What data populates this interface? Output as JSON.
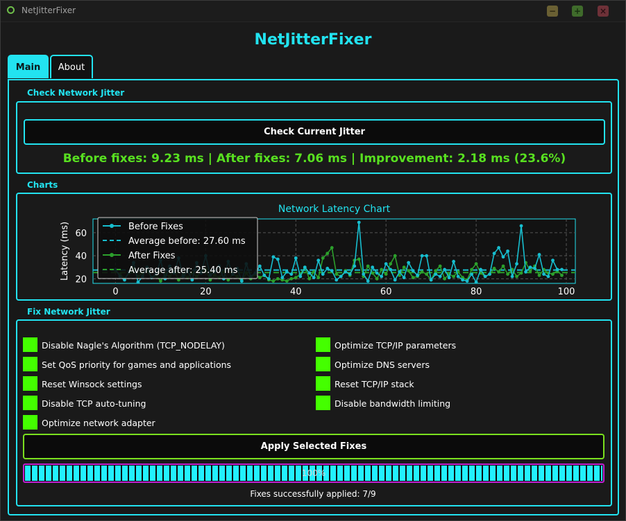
{
  "window": {
    "title": "NetJitterFixer",
    "minimize_glyph": "−",
    "maximize_glyph": "+",
    "close_glyph": "×",
    "icon": "app-ring-icon"
  },
  "app_title": "NetJitterFixer",
  "tabs": [
    {
      "label": "Main",
      "active": true
    },
    {
      "label": "About",
      "active": false
    }
  ],
  "check_section": {
    "label": "Check Network Jitter",
    "button_label": "Check Current Jitter",
    "result_text": "Before fixes: 9.23 ms | After fixes: 7.06 ms | Improvement: 2.18 ms (23.6%)"
  },
  "charts_section": {
    "label": "Charts"
  },
  "chart_data": {
    "type": "line",
    "title": "Network Latency Chart",
    "xlabel": "",
    "ylabel": "Latency (ms)",
    "xlim": [
      -5,
      102
    ],
    "ylim": [
      16,
      72
    ],
    "xticks": [
      0,
      20,
      40,
      60,
      80,
      100
    ],
    "yticks": [
      20,
      40,
      60
    ],
    "grid": true,
    "legend_position": "top-left",
    "series": [
      {
        "name": "Before Fixes",
        "color": "#17becf",
        "values": [
          28,
          22,
          19,
          26,
          34,
          17,
          22,
          30,
          21,
          24,
          36,
          20,
          31,
          25,
          38,
          22,
          27,
          19,
          34,
          25,
          40,
          23,
          26,
          31,
          20,
          35,
          24,
          29,
          18,
          33,
          22,
          25,
          31,
          23,
          20,
          39,
          37,
          21,
          26,
          24,
          38,
          22,
          30,
          25,
          21,
          36,
          24,
          29,
          27,
          19,
          22,
          26,
          24,
          31,
          69,
          24,
          18,
          30,
          25,
          22,
          33,
          28,
          19,
          26,
          21,
          34,
          27,
          23,
          40,
          40,
          19,
          24,
          22,
          28,
          21,
          35,
          22,
          19,
          18,
          24,
          17,
          28,
          22,
          24,
          42,
          47,
          39,
          44,
          22,
          33,
          66,
          26,
          30,
          29,
          41,
          24,
          22,
          36,
          28,
          28
        ]
      },
      {
        "name": "After Fixes",
        "color": "#2ca02c",
        "values": [
          27,
          24,
          20,
          25,
          29,
          22,
          25,
          27,
          21,
          23,
          18,
          24,
          22,
          27,
          19,
          24,
          21,
          25,
          22,
          26,
          28,
          19,
          23,
          21,
          26,
          19,
          24,
          22,
          18,
          25,
          20,
          24,
          21,
          23,
          19,
          18,
          20,
          19,
          18,
          20,
          21,
          24,
          30,
          20,
          26,
          21,
          38,
          42,
          47,
          24,
          22,
          27,
          23,
          36,
          37,
          22,
          31,
          25,
          20,
          28,
          24,
          33,
          40,
          23,
          30,
          27,
          21,
          22,
          26,
          24,
          19,
          27,
          31,
          20,
          24,
          22,
          26,
          21,
          19,
          28,
          33,
          25,
          22,
          24,
          29,
          26,
          31,
          24,
          28,
          22,
          25,
          34,
          27,
          31,
          23,
          28,
          25,
          24,
          27,
          23
        ]
      },
      {
        "name": "Average before: 27.60 ms",
        "color": "#17becf",
        "style": "dashed",
        "value": 27.6
      },
      {
        "name": "Average after: 25.40 ms",
        "color": "#2ca02c",
        "style": "dashed",
        "value": 25.4
      }
    ]
  },
  "fix_section": {
    "label": "Fix Network Jitter",
    "options": [
      {
        "label": "Disable Nagle's Algorithm (TCP_NODELAY)",
        "checked": true
      },
      {
        "label": "Optimize TCP/IP parameters",
        "checked": true
      },
      {
        "label": "Set QoS priority for games and applications",
        "checked": true
      },
      {
        "label": "Optimize DNS servers",
        "checked": true
      },
      {
        "label": "Reset Winsock settings",
        "checked": true
      },
      {
        "label": "Reset TCP/IP stack",
        "checked": true
      },
      {
        "label": "Disable TCP auto-tuning",
        "checked": true
      },
      {
        "label": "Disable bandwidth limiting",
        "checked": true
      },
      {
        "label": "Optimize network adapter",
        "checked": true
      }
    ],
    "apply_button_label": "Apply Selected Fixes",
    "progress_text": "100%",
    "progress_fraction": 1.0,
    "status_text": "Fixes successfully applied: 7/9"
  },
  "colors": {
    "accent": "#22e3f0",
    "success": "#58e020",
    "checkbox": "#44ff00",
    "apply_border": "#7ae01e",
    "progress_border": "#c020d0"
  }
}
